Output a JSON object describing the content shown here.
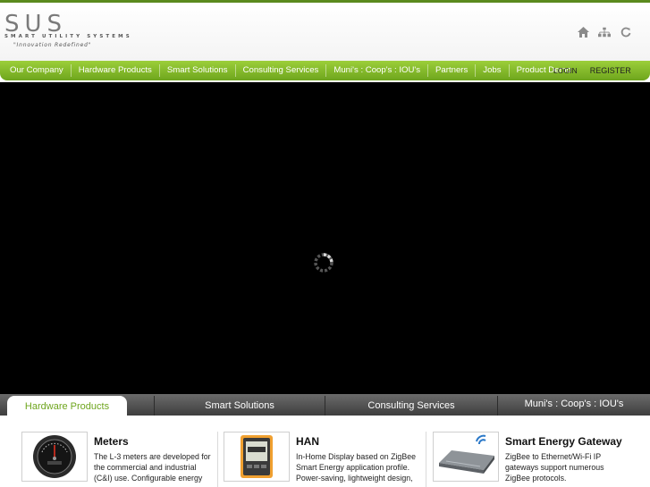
{
  "header": {
    "logo": {
      "mark": "SUS",
      "subtitle": "SMART  UTILITY  SYSTEMS",
      "tagline": "\"Innovation Redefined\""
    },
    "icons": [
      "home-icon",
      "sitemap-icon",
      "refresh-icon"
    ]
  },
  "nav": {
    "items": [
      {
        "label": "Our Company"
      },
      {
        "label": "Hardware Products"
      },
      {
        "label": "Smart Solutions"
      },
      {
        "label": "Consulting Services"
      },
      {
        "label": "Muni's : Coop's : IOU's"
      },
      {
        "label": "Partners"
      },
      {
        "label": "Jobs"
      },
      {
        "label": "Product Demo"
      }
    ],
    "login": "LOGIN",
    "register": "REGISTER"
  },
  "tabs": [
    {
      "label": "Hardware Products",
      "active": true
    },
    {
      "label": "Smart Solutions",
      "active": false
    },
    {
      "label": "Consulting Services",
      "active": false
    },
    {
      "label": "Muni's : Coop's : IOU's",
      "active": false
    }
  ],
  "products": [
    {
      "title": "Meters",
      "desc": "The L-3 meters are developed for the commercial and industrial (C&I) use. Configurable energy",
      "icon": "meter-gauge-icon"
    },
    {
      "title": "HAN",
      "desc": "In-Home Display based on ZigBee Smart Energy application profile. Power-saving, lightweight design,",
      "icon": "in-home-display-icon"
    },
    {
      "title": "Smart Energy Gateway",
      "desc": "ZigBee to Ethernet/Wi-Fi IP gateways support numerous ZigBee protocols.",
      "icon": "gateway-router-icon"
    }
  ],
  "colors": {
    "accent": "#7cb526",
    "nav_dark": "#6ea51d",
    "tabs_bar": "#4a4a4a"
  }
}
